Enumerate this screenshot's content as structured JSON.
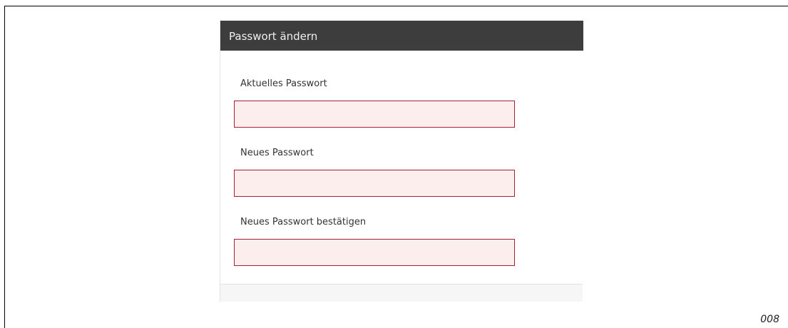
{
  "panel": {
    "title": "Passwort ändern",
    "fields": [
      {
        "label": "Aktuelles Passwort",
        "value": "",
        "placeholder": ""
      },
      {
        "label": "Neues Passwort",
        "value": "",
        "placeholder": ""
      },
      {
        "label": "Neues Passwort bestätigen",
        "value": "",
        "placeholder": ""
      }
    ],
    "colors": {
      "header_background": "#3d3d3d",
      "header_text": "#f0f0f0",
      "input_background": "#fdeeee",
      "input_border_error": "#a52035",
      "footer_background": "#f6f6f6"
    }
  },
  "page_number": "008"
}
